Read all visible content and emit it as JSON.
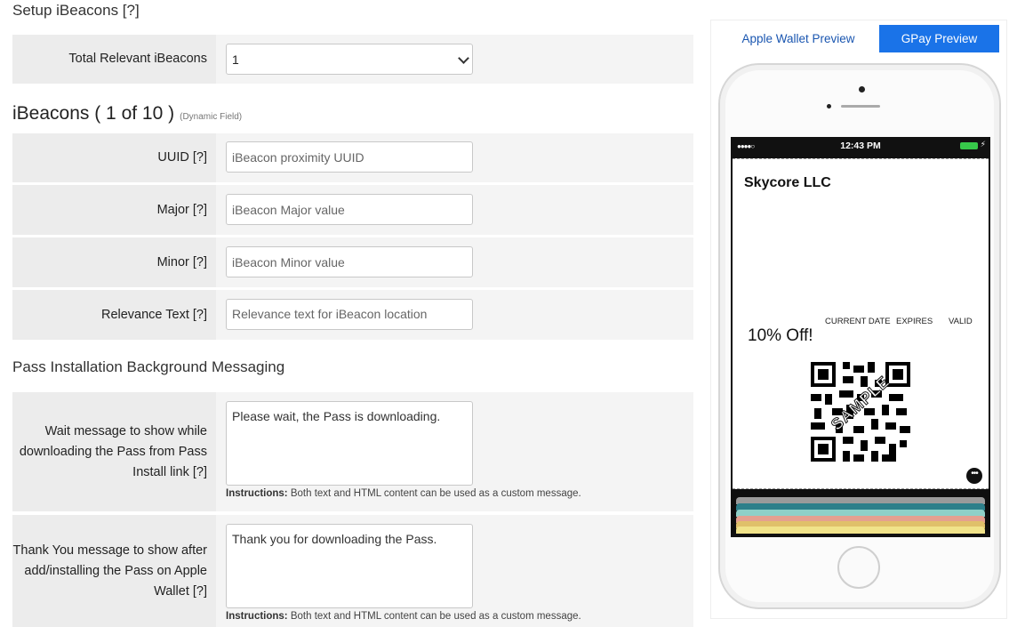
{
  "sections": {
    "setup_title": "Setup iBeacons [?]",
    "ibeacons_title": "iBeacons ( 1 of 10 )",
    "ibeacons_note": "(Dynamic Field)",
    "pass_title": "Pass Installation Background Messaging"
  },
  "fields": {
    "total_label": "Total Relevant iBeacons",
    "total_value": "1",
    "uuid_label": "UUID [?]",
    "uuid_placeholder": "iBeacon proximity UUID",
    "major_label": "Major [?]",
    "major_placeholder": "iBeacon Major value",
    "minor_label": "Minor [?]",
    "minor_placeholder": "iBeacon Minor value",
    "relevance_label": "Relevance Text [?]",
    "relevance_placeholder": "Relevance text for iBeacon location",
    "wait_label": "Wait message to show while downloading the Pass from Pass Install link [?]",
    "wait_value": "Please wait, the Pass is downloading.",
    "thanks_label": "Thank You message to show after add/installing the Pass on Apple Wallet [?]",
    "thanks_value": "Thank you for downloading the Pass.",
    "instructions_bold": "Instructions:",
    "instructions_text": "Both text and HTML content can be used as a custom message."
  },
  "preview": {
    "tab_apple": "Apple Wallet Preview",
    "tab_gpay": "GPay Preview",
    "status_time": "12:43 PM",
    "signal": "●●●●○",
    "company": "Skycore LLC",
    "field_current_date": "CURRENT DATE",
    "field_expires": "EXPIRES",
    "field_valid": "VALID",
    "offer": "10% Off!",
    "watermark": "SAMPLE",
    "more_icon": "more-dots-icon",
    "more_glyph": "•••",
    "bolt": "⚡"
  },
  "colors": {
    "gpay_tab": "#1a73e8",
    "apple_tab_text": "#1a56b0",
    "battery": "#37c84a"
  }
}
